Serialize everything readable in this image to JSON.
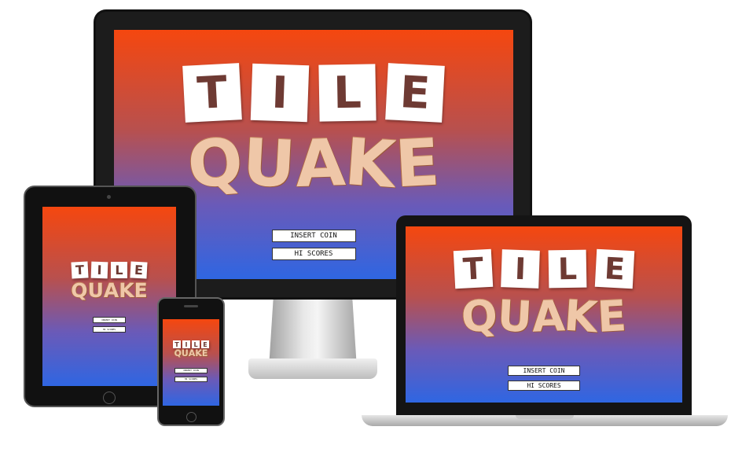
{
  "game": {
    "title_line1": [
      "T",
      "I",
      "L",
      "E"
    ],
    "title_line2": [
      "Q",
      "U",
      "A",
      "K",
      "E"
    ],
    "buttons": {
      "insert_coin": "INSERT COIN",
      "hi_scores": "HI SCORES"
    }
  },
  "colors": {
    "gradient_top": "#f5470f",
    "gradient_bottom": "#2f66e2",
    "tile_letter": "#6e3a33",
    "quake_letter": "#efc7a8"
  }
}
